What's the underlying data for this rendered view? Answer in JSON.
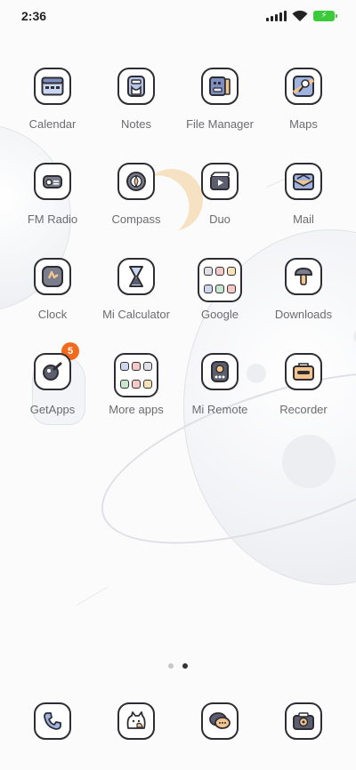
{
  "status_bar": {
    "time": "2:36",
    "battery_glyph": "⚡"
  },
  "apps": [
    {
      "label": "Calendar",
      "icon": "calendar-icon"
    },
    {
      "label": "Notes",
      "icon": "notes-icon"
    },
    {
      "label": "File Manager",
      "icon": "file-manager-icon"
    },
    {
      "label": "Maps",
      "icon": "maps-icon"
    },
    {
      "label": "FM Radio",
      "icon": "radio-icon"
    },
    {
      "label": "Compass",
      "icon": "compass-icon"
    },
    {
      "label": "Duo",
      "icon": "video-camera-icon"
    },
    {
      "label": "Mail",
      "icon": "mail-icon"
    },
    {
      "label": "Clock",
      "icon": "clock-icon"
    },
    {
      "label": "Mi Calculator",
      "icon": "calculator-icon"
    },
    {
      "label": "Google",
      "icon": "folder-icon"
    },
    {
      "label": "Downloads",
      "icon": "download-icon"
    },
    {
      "label": "GetApps",
      "icon": "getapps-icon",
      "badge": "5"
    },
    {
      "label": "More apps",
      "icon": "folder-icon"
    },
    {
      "label": "Mi Remote",
      "icon": "remote-icon"
    },
    {
      "label": "Recorder",
      "icon": "recorder-icon"
    }
  ],
  "dock": [
    {
      "icon": "phone-icon"
    },
    {
      "icon": "messaging-icon"
    },
    {
      "icon": "chat-icon"
    },
    {
      "icon": "camera-icon"
    }
  ],
  "page_indicator": {
    "pages": 2,
    "current": 2
  }
}
